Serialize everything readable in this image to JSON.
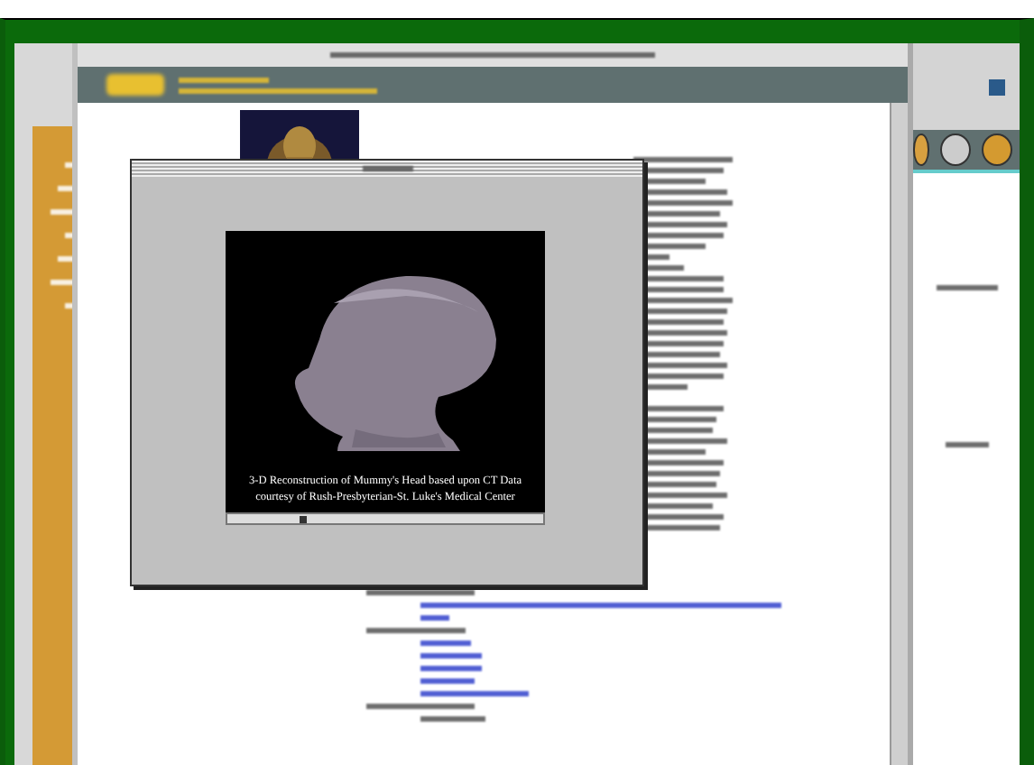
{
  "popup_window": {
    "video": {
      "caption": [
        "3-D Reconstruction of Mummy's Head based upon CT Data",
        "courtesy of Rush-Presbyterian-St. Luke's Medical Center"
      ]
    }
  }
}
